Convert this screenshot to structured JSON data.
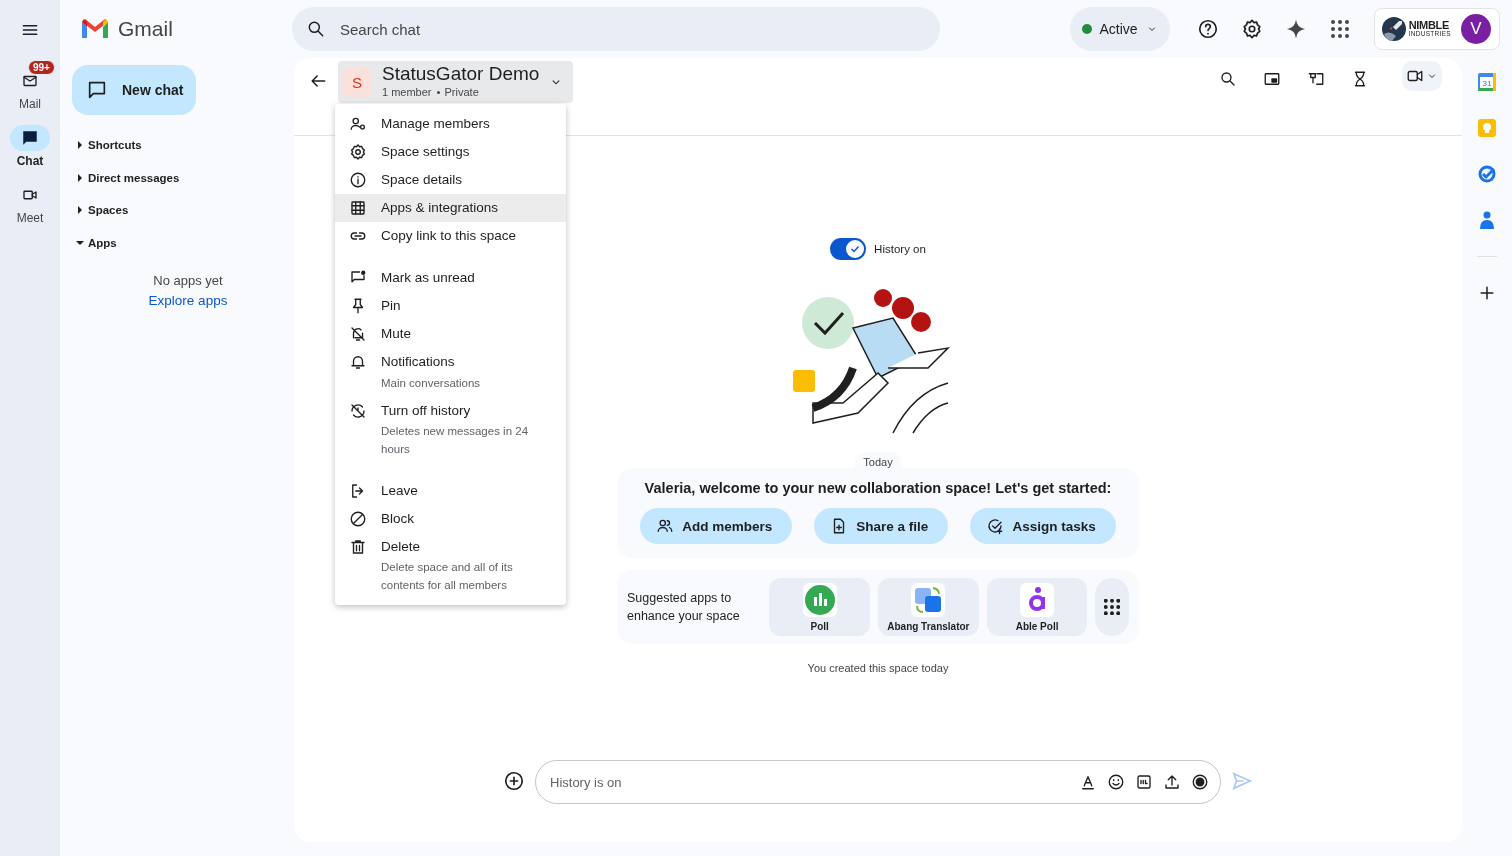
{
  "app_rail": {
    "items": [
      {
        "label": "Mail",
        "badge": "99+",
        "selected": false
      },
      {
        "label": "Chat",
        "selected": true
      },
      {
        "label": "Meet",
        "selected": false
      }
    ]
  },
  "nav": {
    "brand": "Gmail",
    "new_chat": "New chat",
    "sections": [
      {
        "label": "Shortcuts",
        "expanded": false
      },
      {
        "label": "Direct messages",
        "expanded": false
      },
      {
        "label": "Spaces",
        "expanded": false
      },
      {
        "label": "Apps",
        "expanded": true
      }
    ],
    "empty_text": "No apps yet",
    "explore_link": "Explore apps"
  },
  "top_bar": {
    "search": {
      "placeholder": "Search chat"
    },
    "status": "Active",
    "org_logo": {
      "name": "NIMBLE",
      "tagline": "INDUSTRIES"
    },
    "avatar": "V"
  },
  "space": {
    "avatar": "S",
    "name": "StatusGator Demo",
    "members": "1 member",
    "visibility": "Private"
  },
  "menu": {
    "groups": [
      {
        "items": [
          {
            "label": "Manage members",
            "selected": false
          },
          {
            "label": "Space settings",
            "selected": false
          },
          {
            "label": "Space details",
            "selected": false
          },
          {
            "label": "Apps & integrations",
            "selected": true
          },
          {
            "label": "Copy link to this space",
            "selected": false
          }
        ]
      },
      {
        "items": [
          {
            "label": "Mark as unread",
            "selected": false
          },
          {
            "label": "Pin",
            "selected": false
          },
          {
            "label": "Mute",
            "selected": false
          },
          {
            "label": "Notifications",
            "sublabel": "Main conversations",
            "selected": false
          },
          {
            "label": "Turn off history",
            "sublabel": "Deletes new messages in 24 hours",
            "selected": false
          }
        ]
      },
      {
        "items": [
          {
            "label": "Leave",
            "selected": false
          },
          {
            "label": "Block",
            "selected": false
          },
          {
            "label": "Delete",
            "sublabel": "Delete space and all of its contents for all members",
            "selected": false
          }
        ]
      }
    ]
  },
  "history": {
    "label": "History on",
    "on": true
  },
  "date": "Today",
  "welcome": {
    "text": "Valeria, welcome to your new collaboration space! Let's get started:",
    "actions": [
      "Add members",
      "Share a file",
      "Assign tasks"
    ]
  },
  "suggested": {
    "label": "Suggested apps to enhance your space",
    "apps": [
      {
        "name": "Poll"
      },
      {
        "name": "Abang Translator"
      },
      {
        "name": "Able Poll"
      }
    ]
  },
  "created_note": "You created this space today",
  "composer": {
    "placeholder": "History is on"
  },
  "right_rail": {
    "calendar_day": "31"
  }
}
